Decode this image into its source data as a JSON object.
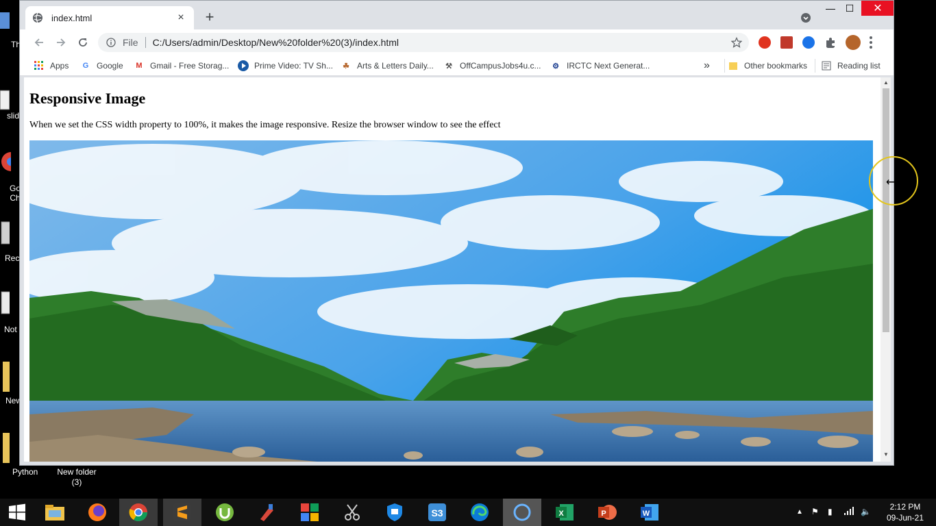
{
  "desktop": {
    "icons": [
      {
        "label": "Th",
        "id": "th"
      },
      {
        "label": "slid",
        "id": "slid"
      },
      {
        "label": "Go Ch",
        "id": "goch"
      },
      {
        "label": "Rec",
        "id": "rec"
      },
      {
        "label": "Not",
        "id": "not"
      },
      {
        "label": "New",
        "id": "new"
      },
      {
        "label": "Python",
        "id": "python"
      },
      {
        "label": "New folder (3)",
        "id": "newfolder3"
      }
    ]
  },
  "browser": {
    "tab": {
      "title": "index.html",
      "close": "×"
    },
    "new_tab": "+",
    "window_controls": {
      "minimize": "—",
      "maximize": "☐",
      "close": "✕"
    },
    "address": {
      "scheme_label": "File",
      "url": "C:/Users/admin/Desktop/New%20folder%20(3)/index.html"
    },
    "bookmarks": [
      {
        "label": "Apps"
      },
      {
        "label": "Google"
      },
      {
        "label": "Gmail - Free Storag..."
      },
      {
        "label": "Prime Video: TV Sh..."
      },
      {
        "label": "Arts & Letters Daily..."
      },
      {
        "label": "OffCampusJobs4u.c..."
      },
      {
        "label": "IRCTC Next Generat..."
      }
    ],
    "overflow": "»",
    "other_bookmarks": "Other bookmarks",
    "reading_list": "Reading list"
  },
  "page": {
    "heading": "Responsive Image",
    "text": "When we set the CSS width property to 100%, it makes the image responsive. Resize the browser window to see the effect"
  },
  "taskbar": {
    "clock_time": "2:12 PM",
    "clock_date": "09-Jun-21"
  },
  "colors": {
    "accent_close": "#e81123",
    "cursor_ring": "#e3c51c"
  }
}
